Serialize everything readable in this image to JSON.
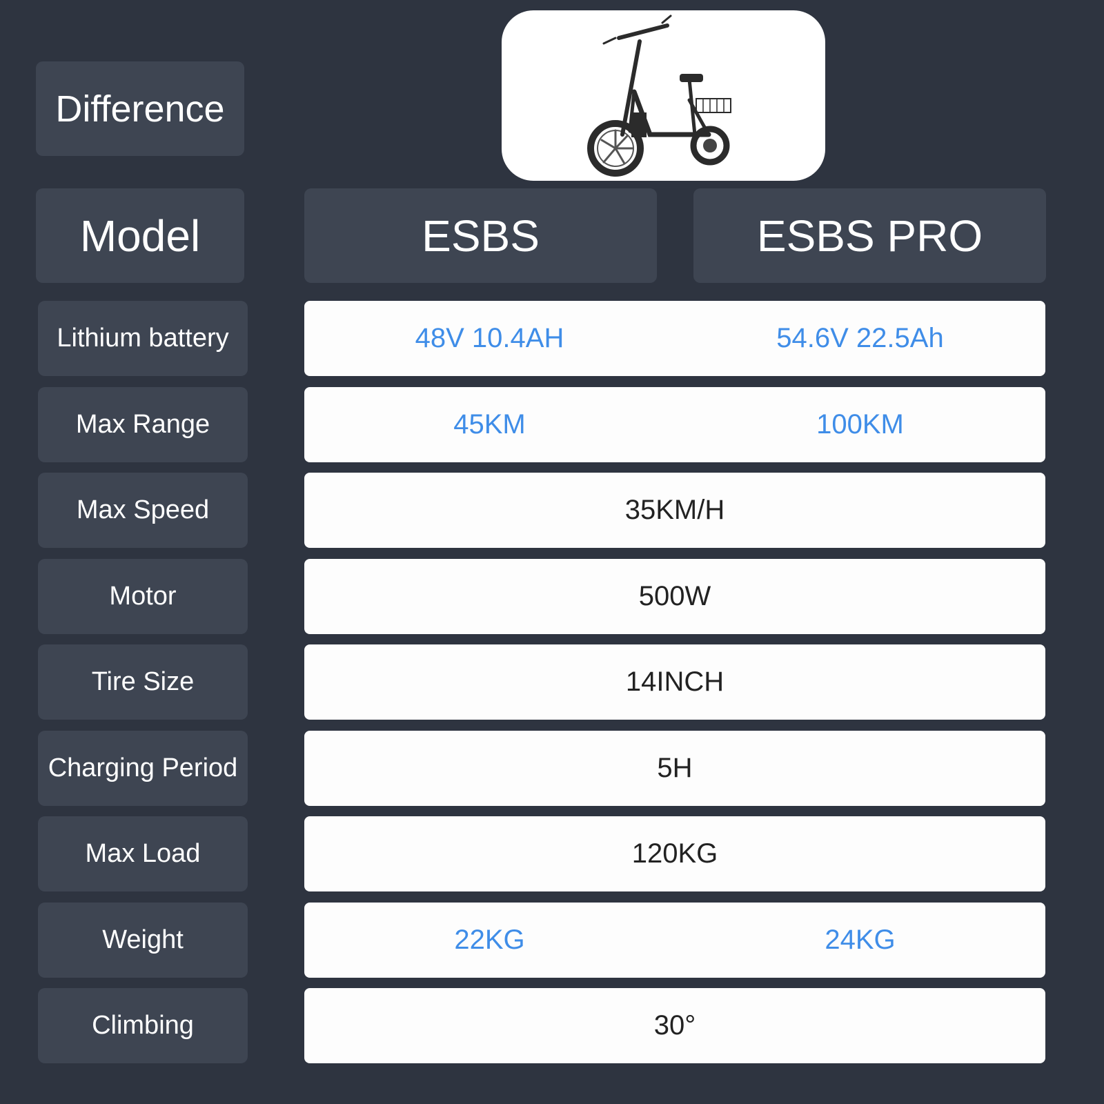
{
  "header": {
    "difference_label": "Difference",
    "model_label": "Model",
    "models": [
      "ESBS",
      "ESBS PRO"
    ]
  },
  "product_image": {
    "alt": "Electric scooter with seat and rear basket"
  },
  "colors": {
    "background": "#2e3440",
    "card": "#3e4552",
    "value_bg": "#fdfdfd",
    "highlight": "#3f8de8",
    "text_dark": "#222222"
  },
  "specs": [
    {
      "label": "Lithium battery",
      "values": [
        "48V 10.4AH",
        "54.6V 22.5Ah"
      ]
    },
    {
      "label": "Max Range",
      "values": [
        "45KM",
        "100KM"
      ]
    },
    {
      "label": "Max Speed",
      "values": [
        "35KM/H"
      ]
    },
    {
      "label": "Motor",
      "values": [
        "500W"
      ]
    },
    {
      "label": "Tire Size",
      "values": [
        "14INCH"
      ]
    },
    {
      "label": "Charging Period",
      "values": [
        "5H"
      ]
    },
    {
      "label": "Max Load",
      "values": [
        "120KG"
      ]
    },
    {
      "label": "Weight",
      "values": [
        "22KG",
        "24KG"
      ]
    },
    {
      "label": "Climbing",
      "values": [
        "30°"
      ]
    }
  ]
}
